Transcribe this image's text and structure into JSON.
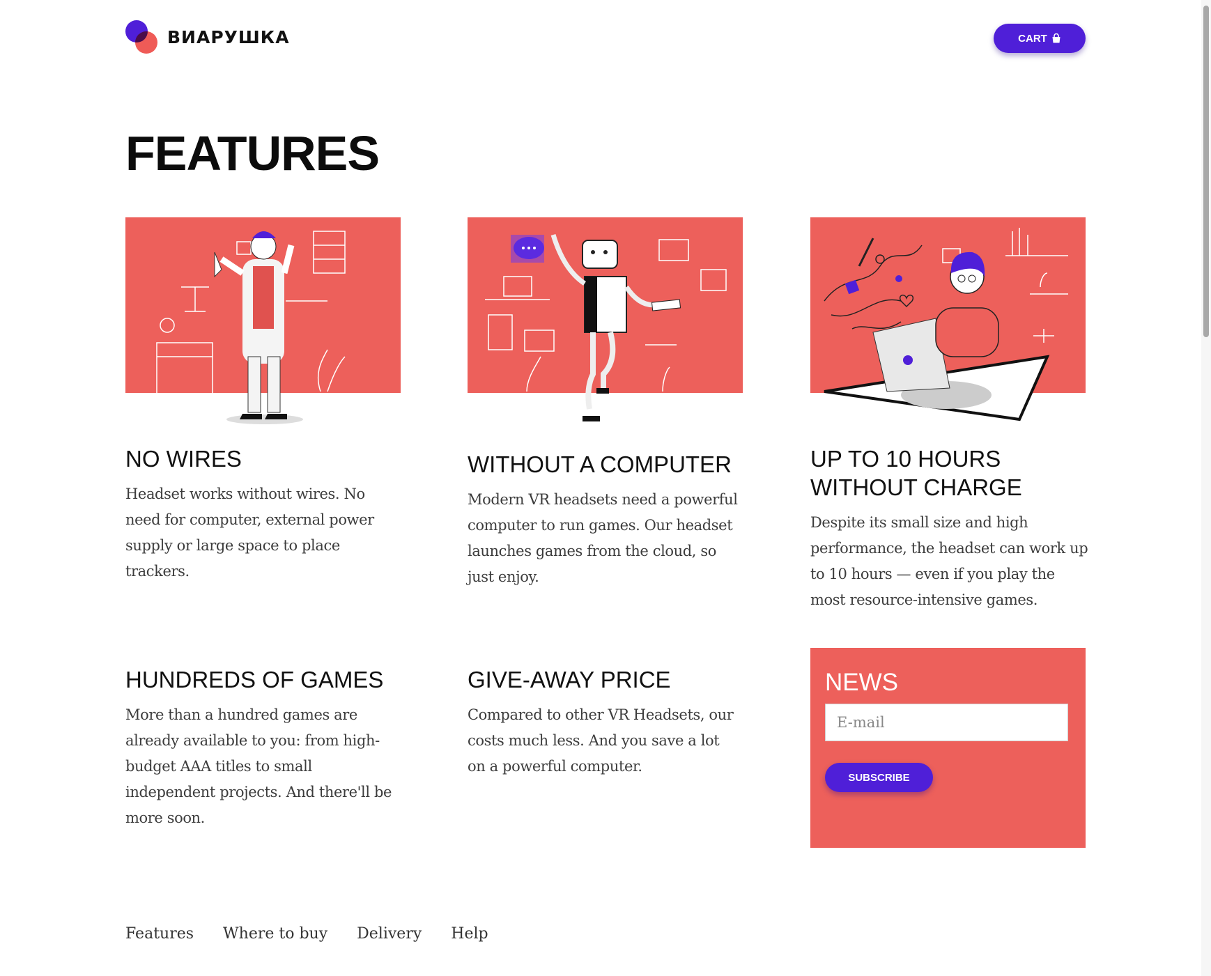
{
  "brand": {
    "name": "ВИАРУШКА",
    "accent": "#4f1fd8",
    "coral": "#ed605b"
  },
  "header": {
    "cart_label": "CART",
    "cart_icon": "shopping-bag-icon"
  },
  "page_title": "FEATURES",
  "features": [
    {
      "title": "NO WIRES",
      "text": "Headset works without wires. No need for computer, external power supply or large space to place trackers.",
      "illustration": "scientist-illustration"
    },
    {
      "title": "WITHOUT A COMPUTER",
      "text": "Modern VR headsets need a powerful computer to run games. Our headset launches games from the cloud, so just enjoy.",
      "illustration": "robot-illustration"
    },
    {
      "title": "UP TO 10 HOURS WITHOUT CHARGE",
      "text": "Despite its small size and high performance, the headset can work up to 10 hours — even if you play the most resource-intensive games.",
      "illustration": "laptop-user-illustration"
    },
    {
      "title": "HUNDREDS OF GAMES",
      "text": "More than a hundred games are already available to you: from high-budget AAA titles to small independent projects. And there'll be more soon."
    },
    {
      "title": "GIVE-AWAY PRICE",
      "text": "Compared to other VR Headsets, our costs much less. And you save a lot on a powerful computer."
    }
  ],
  "news": {
    "title": "NEWS",
    "email_placeholder": "E-mail",
    "email_value": "",
    "subscribe_label": "SUBSCRIBE"
  },
  "footer": {
    "links": [
      "Features",
      "Where to buy",
      "Delivery",
      "Help"
    ]
  }
}
